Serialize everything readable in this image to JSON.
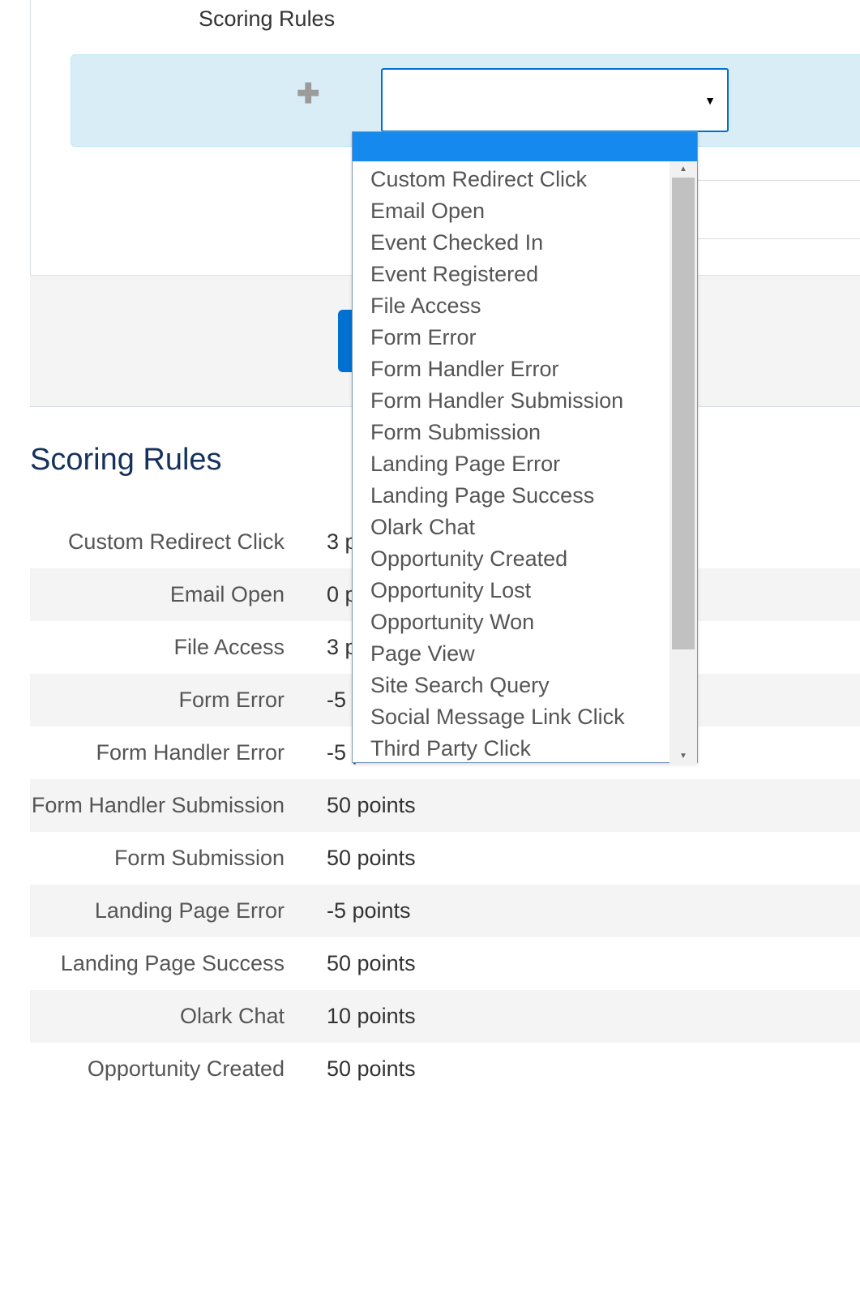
{
  "form": {
    "label": "Scoring Rules",
    "select_value": "",
    "dropdown_options": [
      "Custom Redirect Click",
      "Email Open",
      "Event Checked In",
      "Event Registered",
      "File Access",
      "Form Error",
      "Form Handler Error",
      "Form Handler Submission",
      "Form Submission",
      "Landing Page Error",
      "Landing Page Success",
      "Olark Chat",
      "Opportunity Created",
      "Opportunity Lost",
      "Opportunity Won",
      "Page View",
      "Site Search Query",
      "Social Message Link Click",
      "Third Party Click"
    ]
  },
  "section_heading": "Scoring Rules",
  "rules": [
    {
      "label": "Custom Redirect Click",
      "value": "3 points"
    },
    {
      "label": "Email Open",
      "value": "0 points"
    },
    {
      "label": "File Access",
      "value": "3 points"
    },
    {
      "label": "Form Error",
      "value": "-5 points"
    },
    {
      "label": "Form Handler Error",
      "value": "-5 points"
    },
    {
      "label": "Form Handler Submission",
      "value": "50 points"
    },
    {
      "label": "Form Submission",
      "value": "50 points"
    },
    {
      "label": "Landing Page Error",
      "value": "-5 points"
    },
    {
      "label": "Landing Page Success",
      "value": "50 points"
    },
    {
      "label": "Olark Chat",
      "value": "10 points"
    },
    {
      "label": "Opportunity Created",
      "value": "50 points"
    }
  ]
}
